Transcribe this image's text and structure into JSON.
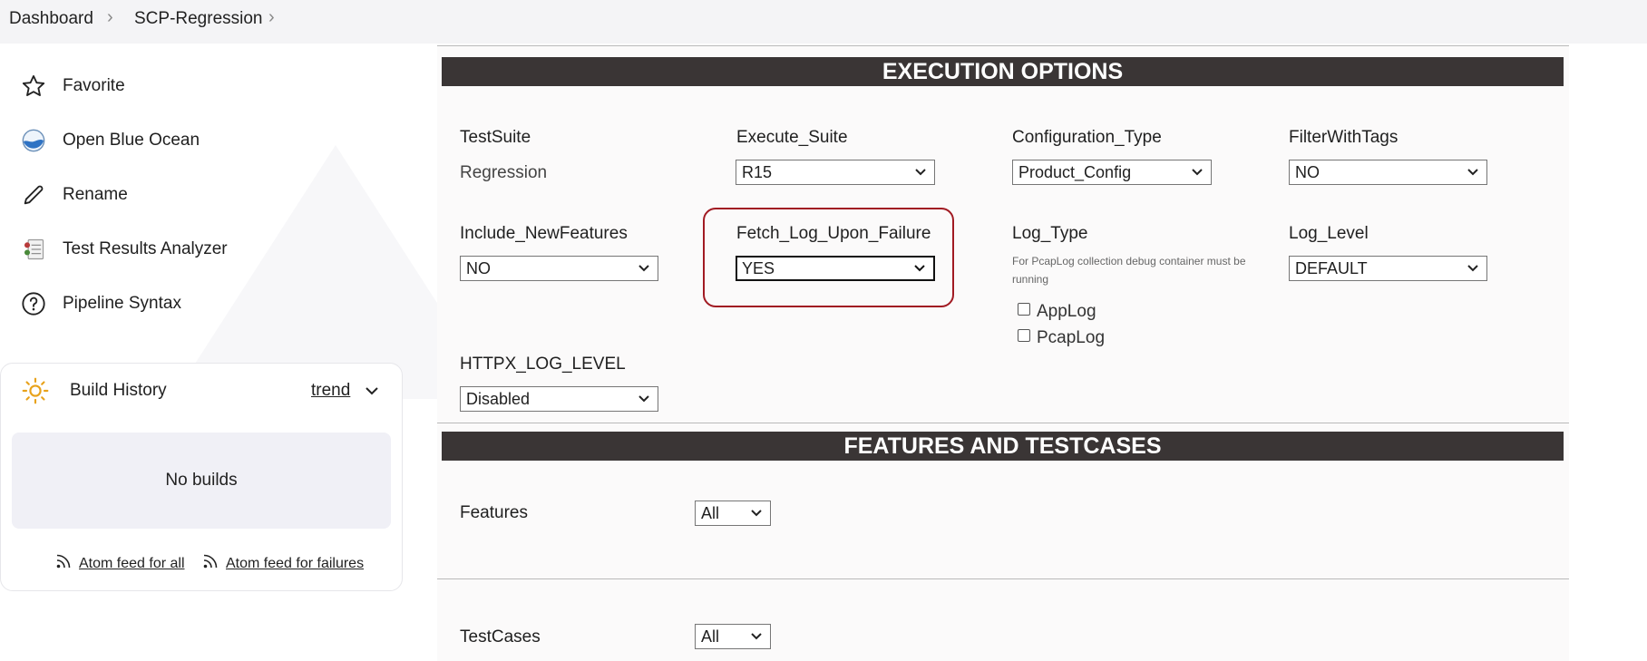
{
  "breadcrumb": {
    "items": [
      "Dashboard",
      "SCP-Regression"
    ]
  },
  "sidebar": {
    "items": [
      {
        "label": "Favorite",
        "icon": "star-icon"
      },
      {
        "label": "Open Blue Ocean",
        "icon": "blue-ocean-icon"
      },
      {
        "label": "Rename",
        "icon": "pencil-icon"
      },
      {
        "label": "Test Results Analyzer",
        "icon": "test-results-icon"
      },
      {
        "label": "Pipeline Syntax",
        "icon": "help-circle-icon"
      }
    ]
  },
  "build_history": {
    "title": "Build History",
    "trend_label": "trend",
    "empty_text": "No builds",
    "feed_all": "Atom feed for all",
    "feed_failures": "Atom feed for failures"
  },
  "execution": {
    "header": "EXECUTION OPTIONS",
    "testsuite": {
      "label": "TestSuite",
      "value": "Regression"
    },
    "execute_suite": {
      "label": "Execute_Suite",
      "value": "R15"
    },
    "configuration_type": {
      "label": "Configuration_Type",
      "value": "Product_Config"
    },
    "filter_with_tags": {
      "label": "FilterWithTags",
      "value": "NO"
    },
    "include_new_features": {
      "label": "Include_NewFeatures",
      "value": "NO"
    },
    "fetch_log": {
      "label": "Fetch_Log_Upon_Failure",
      "value": "YES"
    },
    "log_type": {
      "label": "Log_Type",
      "note": "For PcapLog collection debug container must be running",
      "options": [
        "AppLog",
        "PcapLog"
      ]
    },
    "log_level": {
      "label": "Log_Level",
      "value": "DEFAULT"
    },
    "httpx_log_level": {
      "label": "HTTPX_LOG_LEVEL",
      "value": "Disabled"
    }
  },
  "features": {
    "header": "FEATURES AND TESTCASES",
    "features": {
      "label": "Features",
      "value": "All"
    },
    "testcases": {
      "label": "TestCases",
      "value": "All"
    }
  },
  "colors": {
    "header_bg": "#3a3535",
    "highlight": "#a11a22",
    "accent": "#1f6fbf"
  }
}
